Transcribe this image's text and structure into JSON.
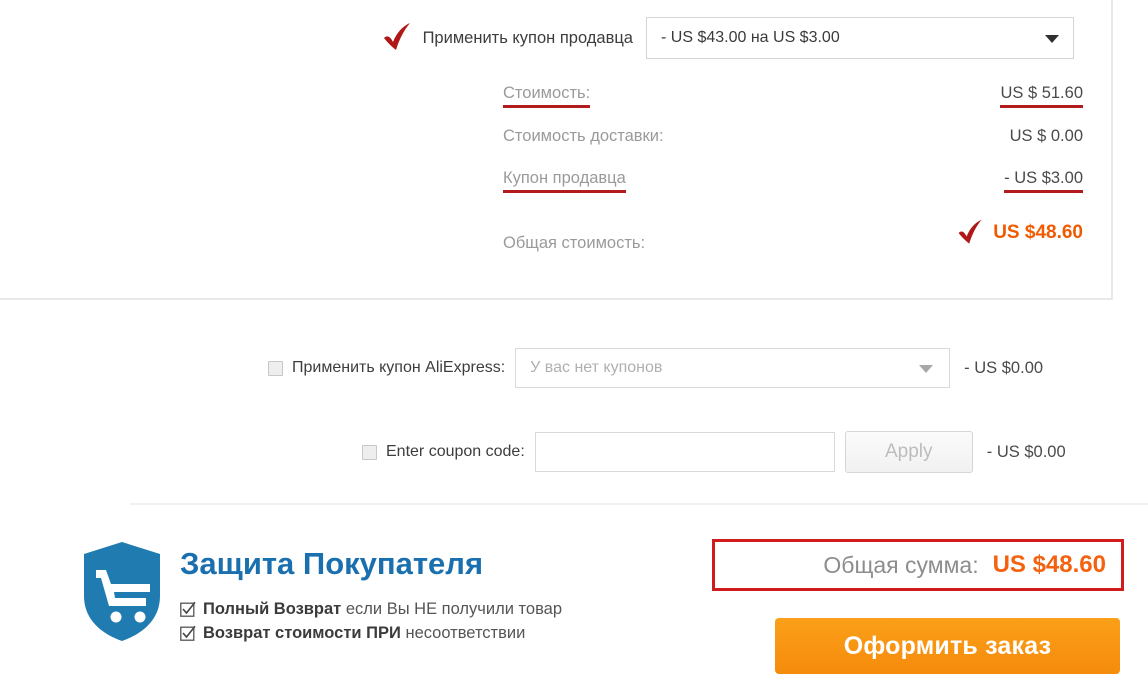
{
  "seller_coupon": {
    "label": "Применить купон продавца",
    "selected_option": "- US $43.00 на US $3.00",
    "checkmark_icon": "red-check-icon",
    "caret_icon": "chevron-down-icon"
  },
  "summary": {
    "subtotal": {
      "label": "Стоимость:",
      "value": "US $ 51.60"
    },
    "shipping": {
      "label": "Стоимость доставки:",
      "value": "US $ 0.00"
    },
    "seller_coupon": {
      "label": "Купон продавца",
      "value": "- US $3.00"
    },
    "total": {
      "label": "Общая стоимость:",
      "value": "US $48.60",
      "checkmark_icon": "red-check-icon"
    }
  },
  "ali_coupon": {
    "label": "Применить купон AliExpress:",
    "placeholder": "У вас нет купонов",
    "amount": "- US $0.00",
    "caret_icon": "chevron-down-icon",
    "checkbox_icon": "checkbox-unchecked-icon"
  },
  "coupon_code": {
    "label": "Enter coupon code:",
    "input_value": "",
    "input_placeholder": "",
    "apply_label": "Apply",
    "amount": "- US $0.00",
    "checkbox_icon": "checkbox-unchecked-icon"
  },
  "buyer_protection": {
    "title": "Защита Покупателя",
    "shield_icon": "shield-cart-icon",
    "items": [
      {
        "icon": "check-box-icon",
        "bold": "Полный Возврат",
        "rest": " если Вы НЕ получили товар"
      },
      {
        "icon": "check-box-icon",
        "bold": "Возврат стоимости ПРИ",
        "rest": " несоответствии"
      }
    ]
  },
  "grand_total": {
    "label": "Общая сумма:",
    "value": "US $48.60"
  },
  "place_order": {
    "label": "Оформить заказ"
  },
  "colors": {
    "accent_orange": "#f4620f",
    "highlight_red": "#d01c1c",
    "brand_blue": "#1a6fae",
    "label_grey": "#9a9a9a"
  }
}
